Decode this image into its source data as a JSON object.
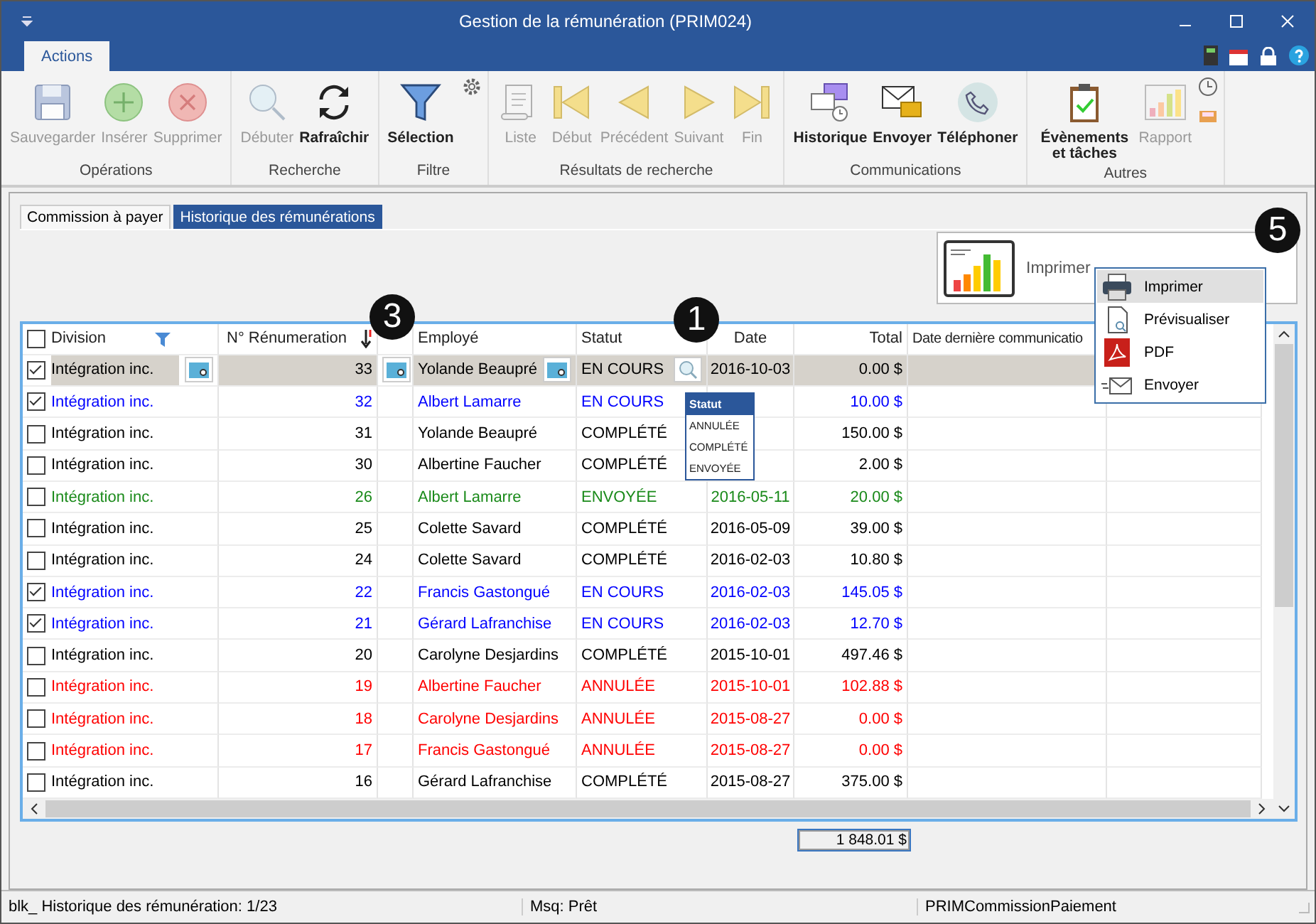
{
  "window": {
    "title": "Gestion de la rémunération (PRIM024)"
  },
  "ribbon_tabs": [
    {
      "label": "Actions",
      "selected": true
    }
  ],
  "ribbon_groups": [
    {
      "label": "Opérations",
      "buttons": [
        {
          "label": "Sauvegarder",
          "disabled": true
        },
        {
          "label": "Insérer",
          "disabled": true
        },
        {
          "label": "Supprimer",
          "disabled": true
        }
      ]
    },
    {
      "label": "Recherche",
      "buttons": [
        {
          "label": "Débuter",
          "disabled": true
        },
        {
          "label": "Rafraîchir",
          "disabled": false
        }
      ]
    },
    {
      "label": "Filtre",
      "buttons": [
        {
          "label": "Sélection",
          "disabled": false
        }
      ]
    },
    {
      "label": "Résultats de recherche",
      "buttons": [
        {
          "label": "Liste",
          "disabled": true
        },
        {
          "label": "Début",
          "disabled": true
        },
        {
          "label": "Précédent",
          "disabled": true
        },
        {
          "label": "Suivant",
          "disabled": true
        },
        {
          "label": "Fin",
          "disabled": true
        }
      ]
    },
    {
      "label": "Communications",
      "buttons": [
        {
          "label": "Historique",
          "disabled": false
        },
        {
          "label": "Envoyer",
          "disabled": false
        },
        {
          "label": "Téléphoner",
          "disabled": false
        }
      ]
    },
    {
      "label": "Autres",
      "buttons": [
        {
          "label": "Évènements et tâches",
          "disabled": false
        },
        {
          "label": "Rapport",
          "disabled": true
        }
      ]
    }
  ],
  "tabs": [
    {
      "label": "Commission à payer",
      "selected": false
    },
    {
      "label": "Historique des rémunérations",
      "selected": true
    }
  ],
  "print_card": {
    "label": "Imprimer"
  },
  "print_menu": [
    {
      "label": "Imprimer",
      "selected": true
    },
    {
      "label": "Prévisualiser",
      "selected": false
    },
    {
      "label": "PDF",
      "selected": false
    },
    {
      "label": "Envoyer",
      "selected": false
    }
  ],
  "table": {
    "all_checked": false,
    "columns": [
      "Division",
      "N° Rénumeration",
      "Employé",
      "Statut",
      "Date",
      "Total",
      "Date dernière communicatio"
    ],
    "rows": [
      {
        "checked": true,
        "selected": true,
        "color": "#000000",
        "division": "Intégration inc.",
        "number": "33",
        "employee": "Yolande Beaupré",
        "status": "EN COURS",
        "date": "2016-10-03",
        "total": "0.00 $"
      },
      {
        "checked": true,
        "selected": false,
        "color": "#0000ff",
        "division": "Intégration inc.",
        "number": "32",
        "employee": "Albert Lamarre",
        "status": "EN COURS",
        "total": "10.00 $"
      },
      {
        "checked": false,
        "selected": false,
        "color": "#000000",
        "division": "Intégration inc.",
        "number": "31",
        "employee": "Yolande Beaupré",
        "status": "COMPLÉTÉ",
        "total": "150.00 $"
      },
      {
        "checked": false,
        "selected": false,
        "color": "#000000",
        "division": "Intégration inc.",
        "number": "30",
        "employee": "Albertine Faucher",
        "status": "COMPLÉTÉ",
        "total": "2.00 $"
      },
      {
        "checked": false,
        "selected": false,
        "color": "#1a8a1a",
        "division": "Intégration inc.",
        "number": "26",
        "employee": "Albert Lamarre",
        "status": "ENVOYÉE",
        "date": "2016-05-11",
        "total": "20.00 $"
      },
      {
        "checked": false,
        "selected": false,
        "color": "#000000",
        "division": "Intégration inc.",
        "number": "25",
        "employee": "Colette Savard",
        "status": "COMPLÉTÉ",
        "date": "2016-05-09",
        "total": "39.00 $"
      },
      {
        "checked": false,
        "selected": false,
        "color": "#000000",
        "division": "Intégration inc.",
        "number": "24",
        "employee": "Colette Savard",
        "status": "COMPLÉTÉ",
        "date": "2016-02-03",
        "total": "10.80 $"
      },
      {
        "checked": true,
        "selected": false,
        "color": "#0000ff",
        "division": "Intégration inc.",
        "number": "22",
        "employee": "Francis Gastongué",
        "status": "EN COURS",
        "date": "2016-02-03",
        "total": "145.05 $"
      },
      {
        "checked": true,
        "selected": false,
        "color": "#0000ff",
        "division": "Intégration inc.",
        "number": "21",
        "employee": "Gérard Lafranchise",
        "status": "EN COURS",
        "date": "2016-02-03",
        "total": "12.70 $"
      },
      {
        "checked": false,
        "selected": false,
        "color": "#000000",
        "division": "Intégration inc.",
        "number": "20",
        "employee": "Carolyne Desjardins",
        "status": "COMPLÉTÉ",
        "date": "2015-10-01",
        "total": "497.46 $"
      },
      {
        "checked": false,
        "selected": false,
        "color": "#ff0000",
        "division": "Intégration inc.",
        "number": "19",
        "employee": "Albertine Faucher",
        "status": "ANNULÉE",
        "date": "2015-10-01",
        "total": "102.88 $"
      },
      {
        "checked": false,
        "selected": false,
        "color": "#ff0000",
        "division": "Intégration inc.",
        "number": "18",
        "employee": "Carolyne Desjardins",
        "status": "ANNULÉE",
        "date": "2015-08-27",
        "total": "0.00 $"
      },
      {
        "checked": false,
        "selected": false,
        "color": "#ff0000",
        "division": "Intégration inc.",
        "number": "17",
        "employee": "Francis Gastongué",
        "status": "ANNULÉE",
        "date": "2015-08-27",
        "total": "0.00 $"
      },
      {
        "checked": false,
        "selected": false,
        "color": "#000000",
        "division": "Intégration inc.",
        "number": "16",
        "employee": "Gérard Lafranchise",
        "status": "COMPLÉTÉ",
        "date": "2015-08-27",
        "total": "375.00 $"
      }
    ],
    "grand_total": "1 848.01 $"
  },
  "status_filter": {
    "title": "Statut",
    "options": [
      "ANNULÉE",
      "COMPLÉTÉ",
      "ENVOYÉE"
    ]
  },
  "callouts": [
    {
      "label": "1"
    },
    {
      "label": "3"
    },
    {
      "label": "5"
    }
  ],
  "status_bar": [
    "blk_ Historique des rémunération: 1/23",
    "Msq: Prêt",
    "PRIMCommissionPaiement"
  ]
}
